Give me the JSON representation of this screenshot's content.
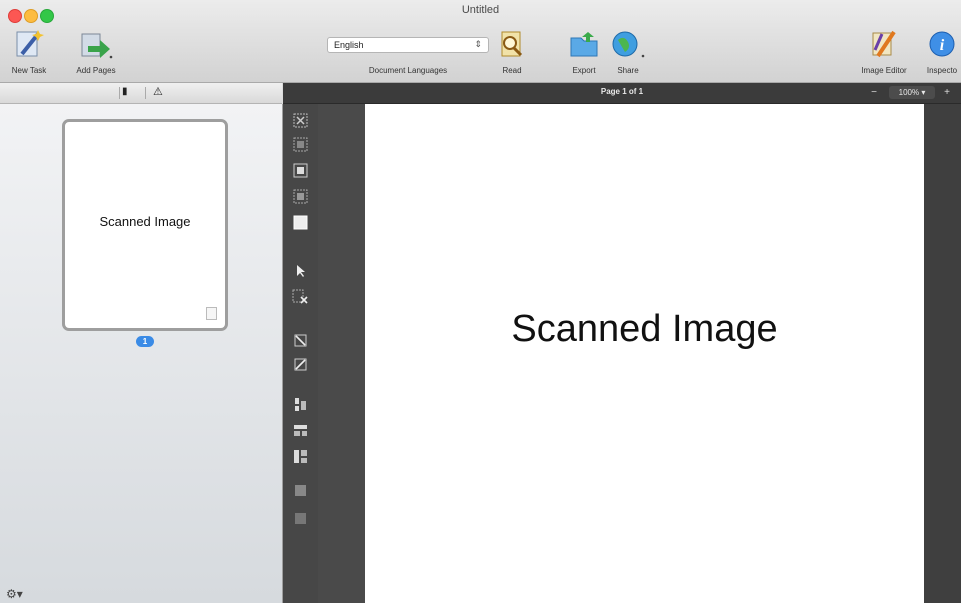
{
  "window": {
    "title": "Untitled"
  },
  "toolbar": {
    "new_task_label": "New Task",
    "add_pages_label": "Add Pages",
    "language_value": "English",
    "language_label": "Document Languages",
    "read_label": "Read",
    "export_label": "Export",
    "share_label": "Share",
    "image_editor_label": "Image Editor",
    "inspector_label": "Inspecto"
  },
  "sidebar": {
    "thumbnail_text": "Scanned Image",
    "page_badge": "1"
  },
  "viewer": {
    "page_indicator": "Page 1 of 1",
    "zoom_minus": "−",
    "zoom_value": "100% ▾",
    "zoom_plus": "+",
    "page_text": "Scanned Image"
  },
  "colors": {
    "accent": "#3a8be6",
    "viewer_bg": "#4a4a4a",
    "toolstrip_bg": "#474747"
  }
}
